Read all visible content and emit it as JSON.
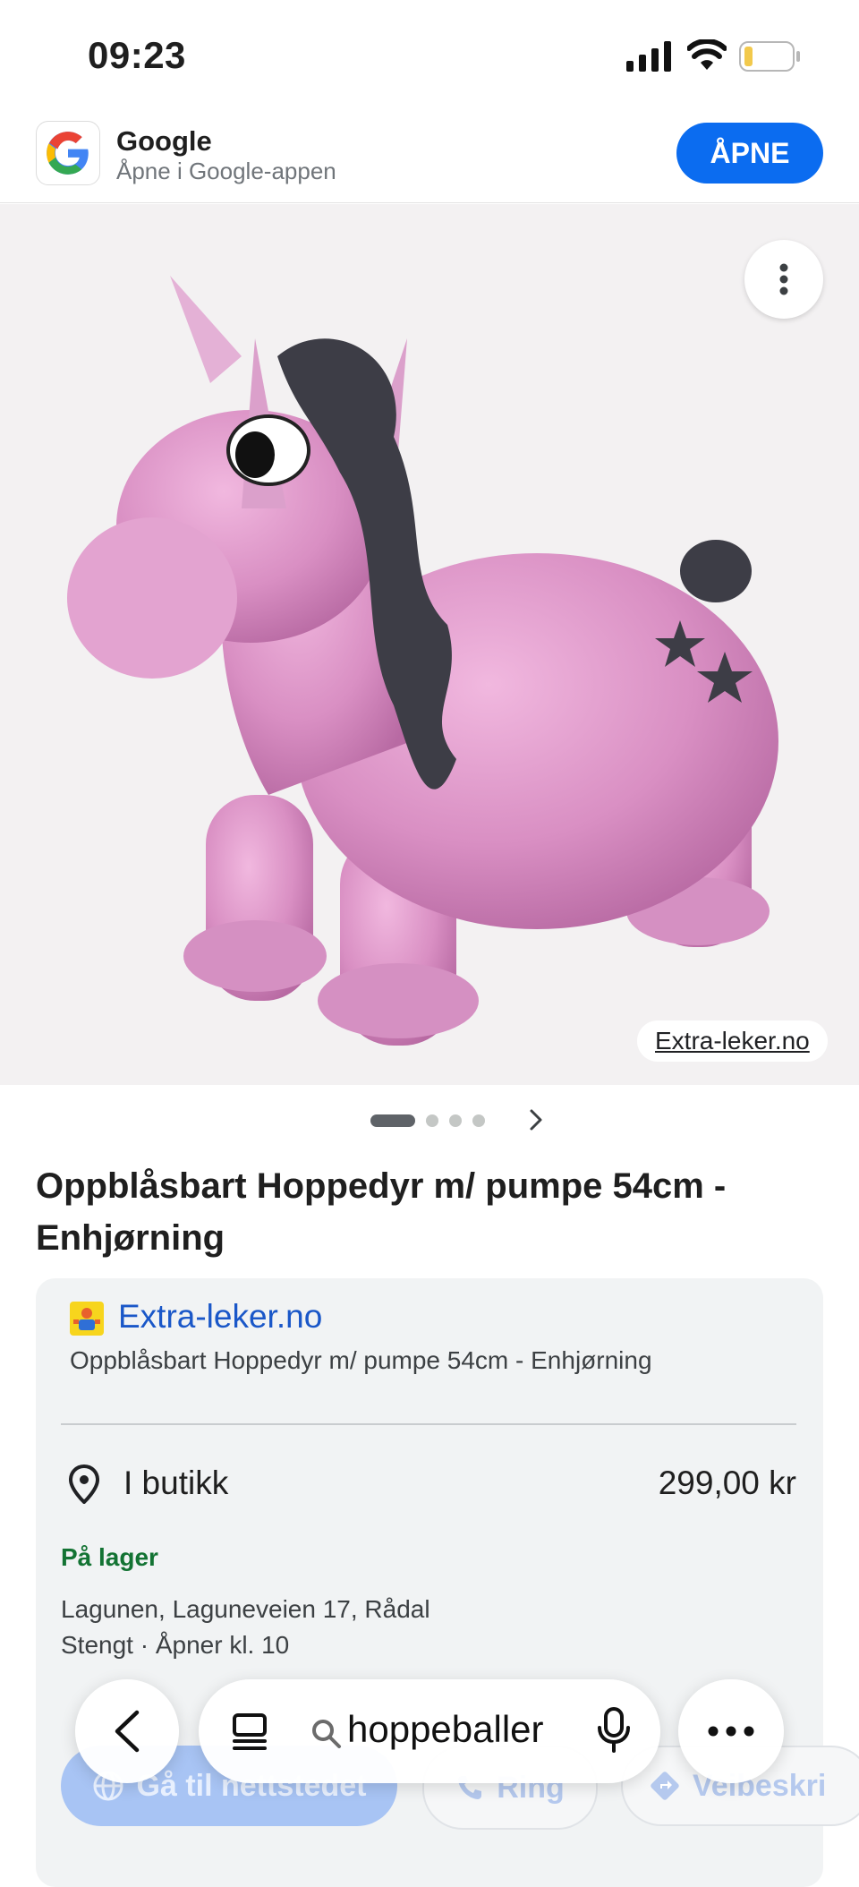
{
  "status_bar": {
    "time": "09:23"
  },
  "app_banner": {
    "app_name": "Google",
    "subtitle": "Åpne i Google-appen",
    "open_label": "ÅPNE"
  },
  "hero": {
    "source_label": "Extra-leker.no"
  },
  "carousel": {
    "total": 4,
    "active_index": 0
  },
  "product": {
    "title": "Oppblåsbart Hoppedyr m/ pumpe 54cm - Enhjørning"
  },
  "offer": {
    "seller": "Extra-leker.no",
    "description": "Oppblåsbart Hoppedyr m/ pumpe 54cm - Enhjørning",
    "channel": "I butikk",
    "price": "299,00 kr",
    "stock": "På lager",
    "address": "Lagunen, Laguneveien 17, Rådal",
    "hours": "Stengt · Åpner kl. 10",
    "actions": {
      "website": "Gå til nettstedet",
      "call": "Ring",
      "directions": "Veibeskri"
    }
  },
  "browser": {
    "search_query": "hoppeballer"
  },
  "colors": {
    "accent": "#0b6cf0",
    "link": "#1a57c8",
    "in_stock": "#137333",
    "unicorn": "#d98fc3"
  }
}
